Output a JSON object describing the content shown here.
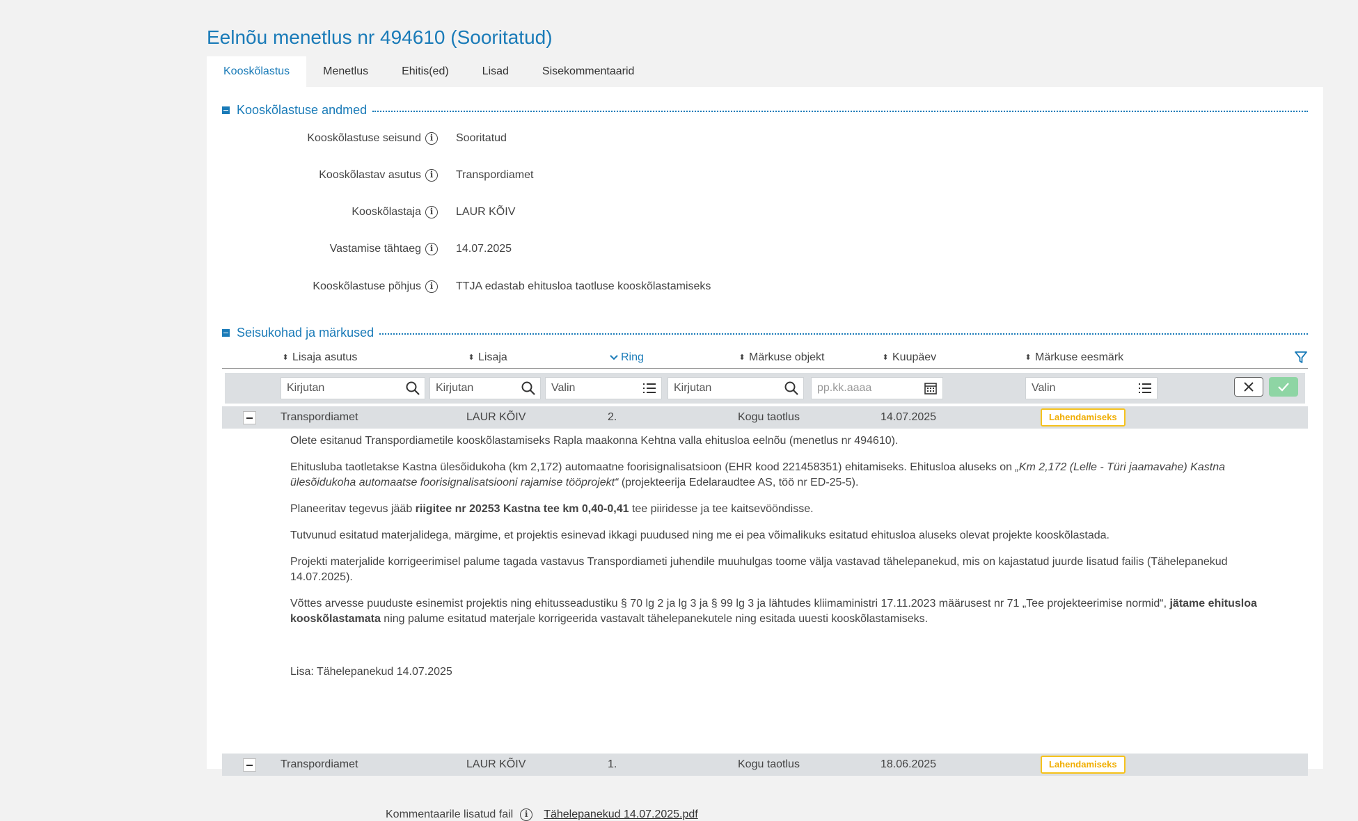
{
  "page": {
    "title": "Eelnõu menetlus nr 494610 (Sooritatud)"
  },
  "tabs": [
    {
      "label": "Kooskõlastus",
      "active": true
    },
    {
      "label": "Menetlus"
    },
    {
      "label": "Ehitis(ed)"
    },
    {
      "label": "Lisad"
    },
    {
      "label": "Sisekommentaarid"
    }
  ],
  "sections": {
    "details_title": "Kooskõlastuse andmed",
    "opinions_title": "Seisukohad ja märkused"
  },
  "details": [
    {
      "label": "Kooskõlastuse seisund",
      "value": "Sooritatud"
    },
    {
      "label": "Kooskõlastav asutus",
      "value": "Transpordiamet"
    },
    {
      "label": "Kooskõlastaja",
      "value": "LAUR KÕIV"
    },
    {
      "label": "Vastamise tähtaeg",
      "value": "14.07.2025"
    },
    {
      "label": "Kooskõlastuse põhjus",
      "value": "TTJA edastab ehitusloa taotluse kooskõlastamiseks"
    }
  ],
  "table": {
    "columns": [
      "Lisaja asutus",
      "Lisaja",
      "Ring",
      "Märkuse objekt",
      "Kuupäev",
      "Märkuse eesmärk"
    ],
    "filters": {
      "asutus_placeholder": "Kirjutan",
      "lisaja_placeholder": "Kirjutan",
      "ring_placeholder": "Valin",
      "objekt_placeholder": "Kirjutan",
      "kuupaev_placeholder": "pp.kk.aaaa",
      "eesmark_placeholder": "Valin"
    },
    "rows": [
      {
        "asutus": "Transpordiamet",
        "lisaja": "LAUR KÕIV",
        "ring": "2.",
        "objekt": "Kogu taotlus",
        "kuupaev": "14.07.2025",
        "eesmark": "Lahendamiseks"
      },
      {
        "asutus": "Transpordiamet",
        "lisaja": "LAUR KÕIV",
        "ring": "1.",
        "objekt": "Kogu taotlus",
        "kuupaev": "18.06.2025",
        "eesmark": "Lahendamiseks"
      }
    ]
  },
  "comment": {
    "p1": "Olete esitanud Transpordiametile kooskõlastamiseks Rapla maakonna Kehtna valla ehitusloa eelnõu (menetlus nr 494610).",
    "p2_start": "Ehitusluba taotletakse Kastna ülesõidukoha (km 2,172) automaatne foorisignalisatsioon (EHR kood 221458351) ehitamiseks. Ehitusloa aluseks on ",
    "p2_italic": "„Km 2,172 (Lelle - Türi jaamavahe) Kastna ülesõidukoha automaatse foorisignalisatsiooni rajamise tööprojekt“",
    "p2_end": " (projekteerija Edelaraudtee AS, töö nr ED-25-5).",
    "p3_start": "Planeeritav tegevus jääb ",
    "p3_bold": "riigitee nr 20253 Kastna tee km 0,40-0,41",
    "p3_end": " tee piiridesse ja tee kaitsevööndisse.",
    "p4": "Tutvunud esitatud materjalidega, märgime, et projektis esinevad ikkagi puudused ning me ei pea võimalikuks esitatud ehitusloa aluseks olevat projekte kooskõlastada.",
    "p5": "Projekti materjalide korrigeerimisel palume tagada vastavus Transpordiameti juhendile muuhulgas toome välja vastavad tähelepanekud, mis on kajastatud juurde lisatud failis (Tähelepanekud 14.07.2025).",
    "p6_start": "Võttes arvesse puuduste esinemist projektis ning ehitusseadustiku § 70 lg 2 ja lg 3 ja § 99 lg 3 ja lähtudes kliimaministri 17.11.2023 määrusest nr 71 „Tee projekteerimise normid“, ",
    "p6_bold": "jätame ehitusloa kooskõlastamata",
    "p6_end": " ning palume esitatud materjale korrigeerida vastavalt tähelepanekutele ning esitada uuesti kooskõlastamiseks.",
    "lisa": "Lisa: Tähelepanekud 14.07.2025",
    "attachment_label": "Kommentaarile lisatud fail",
    "attachment_file": "Tähelepanekud 14.07.2025.pdf"
  }
}
